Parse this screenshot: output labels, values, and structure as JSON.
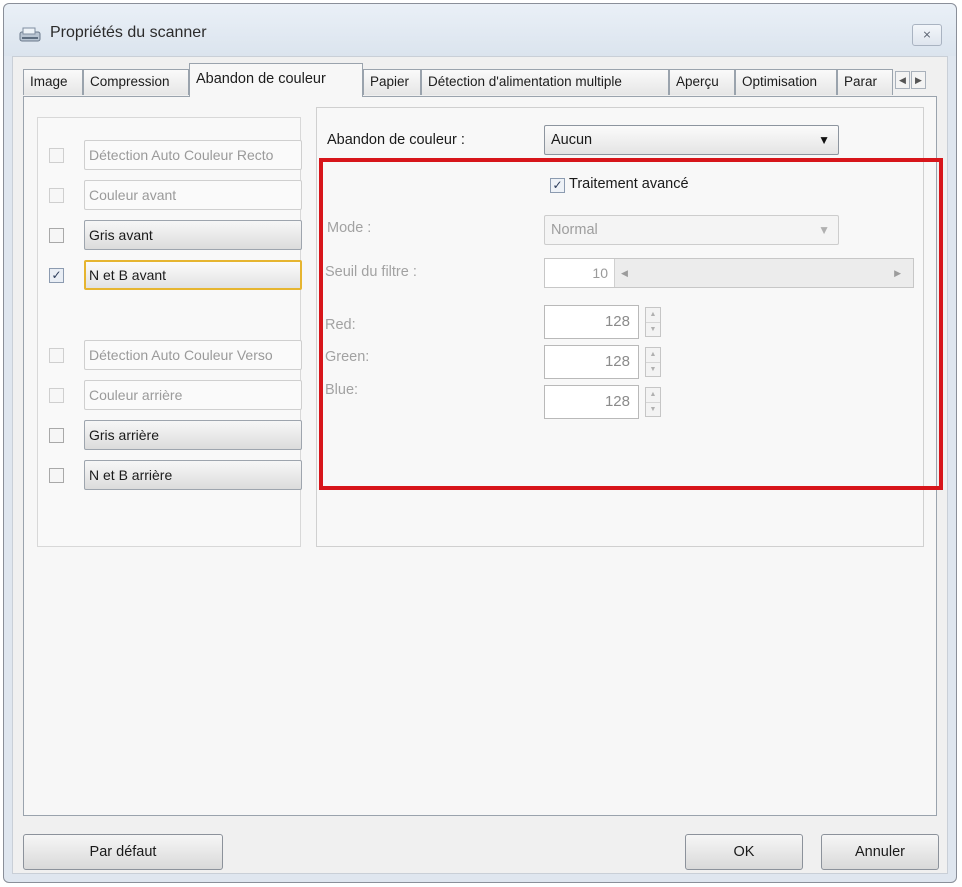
{
  "window": {
    "title": "Propriétés du scanner",
    "close_glyph": "⨯"
  },
  "tabs": [
    {
      "label": "Image"
    },
    {
      "label": "Compression"
    },
    {
      "label": "Abandon de couleur",
      "active": true
    },
    {
      "label": "Papier"
    },
    {
      "label": "Détection d'alimentation multiple"
    },
    {
      "label": "Aperçu"
    },
    {
      "label": "Optimisation"
    },
    {
      "label": "Parar"
    }
  ],
  "tab_scroll": {
    "left": "◀",
    "right": "▶"
  },
  "image_list": [
    {
      "label": "Détection Auto Couleur Recto",
      "checked": false,
      "enabled": false
    },
    {
      "label": "Couleur avant",
      "checked": false,
      "enabled": false
    },
    {
      "label": "Gris avant",
      "checked": false,
      "enabled": true
    },
    {
      "label": "N et B avant",
      "checked": true,
      "enabled": true,
      "focused": true
    },
    {
      "label": "Détection Auto Couleur Verso",
      "checked": false,
      "enabled": false
    },
    {
      "label": "Couleur arrière",
      "checked": false,
      "enabled": false
    },
    {
      "label": "Gris arrière",
      "checked": false,
      "enabled": true
    },
    {
      "label": "N et B arrière",
      "checked": false,
      "enabled": true
    }
  ],
  "dropout": {
    "label": "Abandon de couleur :",
    "value": "Aucun",
    "advanced_label": "Traitement avancé",
    "advanced_checked": true,
    "mode_label": "Mode :",
    "mode_value": "Normal",
    "threshold_label": "Seuil du filtre :",
    "threshold_value": "10",
    "red_label": "Red:",
    "red_value": "128",
    "green_label": "Green:",
    "green_value": "128",
    "blue_label": "Blue:",
    "blue_value": "128"
  },
  "glyphs": {
    "check": "✓",
    "dropdown": "▼",
    "spin_up": "▲",
    "spin_down": "▼",
    "left_arrow": "◀",
    "right_arrow": "▶"
  },
  "footer": {
    "default_label": "Par défaut",
    "ok_label": "OK",
    "cancel_label": "Annuler"
  },
  "colors": {
    "highlight": "#d7151a",
    "focus": "#e6b530"
  }
}
